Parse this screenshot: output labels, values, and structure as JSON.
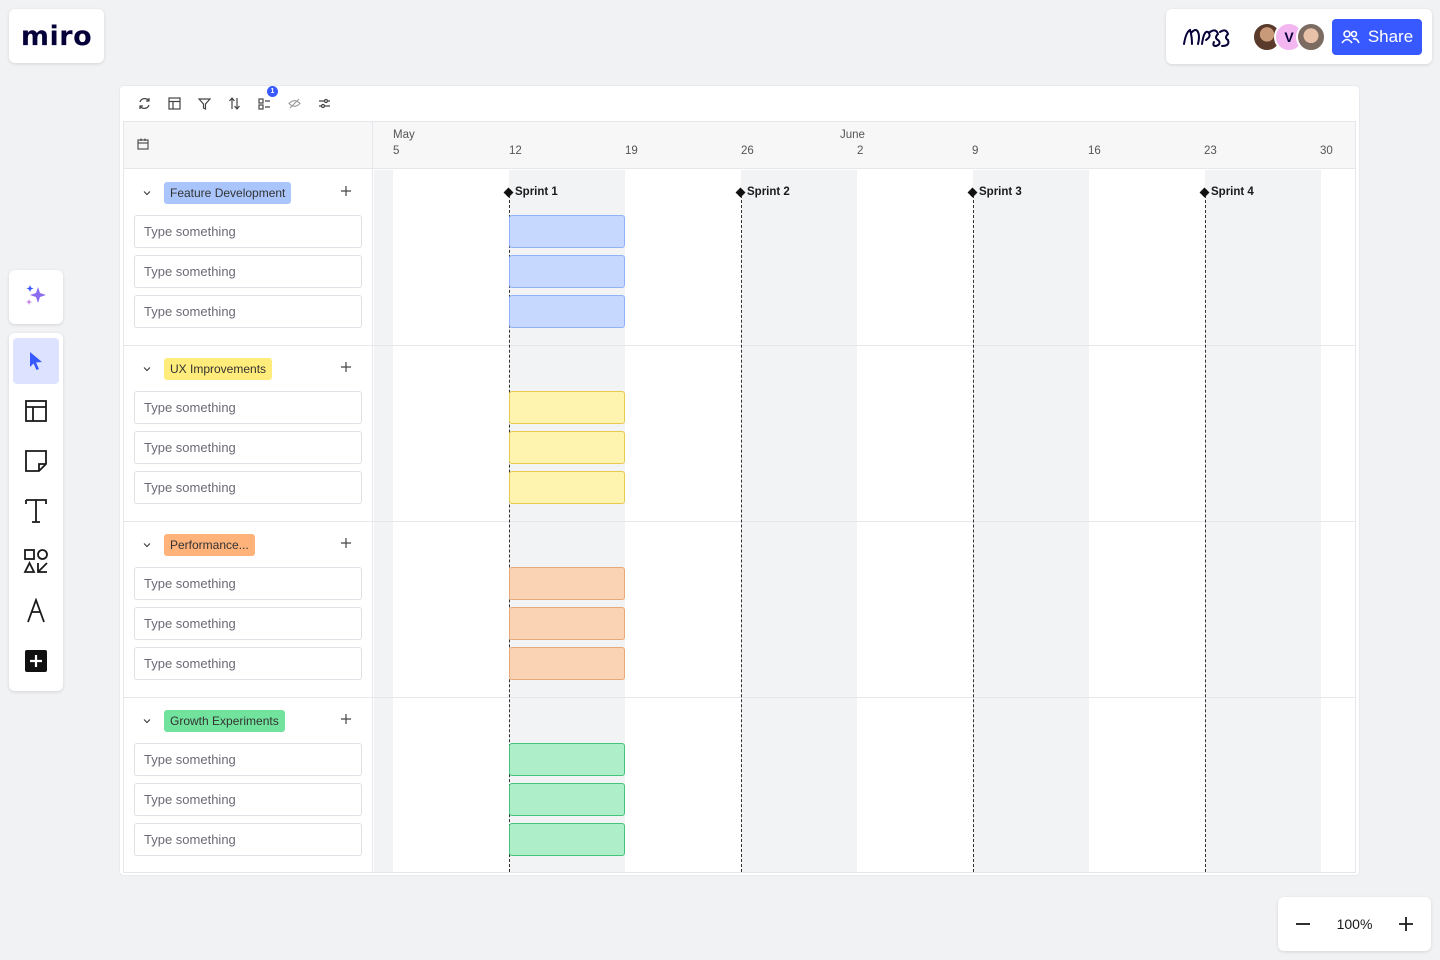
{
  "app": {
    "logo": "miro"
  },
  "header": {
    "share_label": "Share",
    "avatar_initial": "V"
  },
  "board": {
    "timeline": {
      "months": [
        {
          "label": "May"
        },
        {
          "label": "June"
        }
      ],
      "dates": [
        "5",
        "12",
        "19",
        "26",
        "2",
        "9",
        "16",
        "23",
        "30"
      ],
      "sprints": [
        "Sprint 1",
        "Sprint 2",
        "Sprint 3",
        "Sprint 4"
      ]
    },
    "groups": [
      {
        "name": "Feature Development",
        "color": "#a9c5fb",
        "bar_color": "blue",
        "items": [
          "Type something",
          "Type something",
          "Type something"
        ]
      },
      {
        "name": "UX Improvements",
        "color": "#ffec7a",
        "bar_color": "yellow",
        "items": [
          "Type something",
          "Type something",
          "Type something"
        ]
      },
      {
        "name": "Performance...",
        "color": "#ffb27a",
        "bar_color": "orange",
        "items": [
          "Type something",
          "Type something",
          "Type something"
        ]
      },
      {
        "name": "Growth Experiments",
        "color": "#72e39d",
        "bar_color": "green",
        "items": [
          "Type something",
          "Type something",
          "Type something"
        ]
      }
    ],
    "toolbar_badge": "1"
  },
  "zoom": {
    "value": "100%"
  }
}
